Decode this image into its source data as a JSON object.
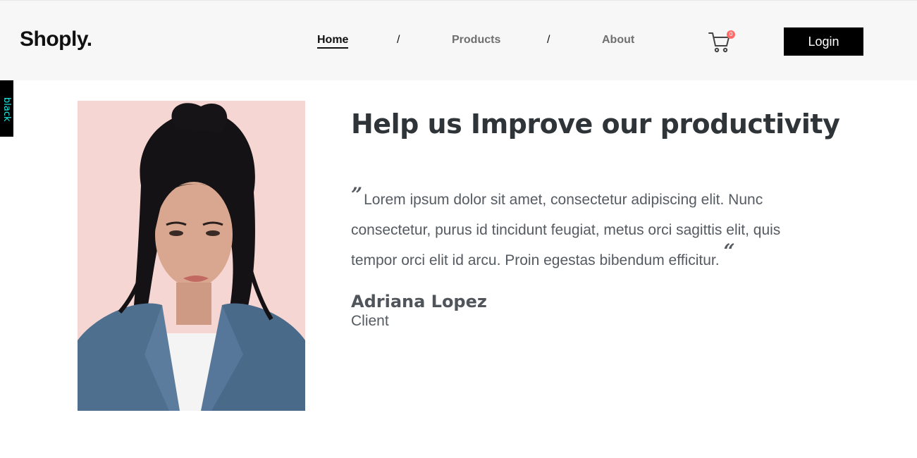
{
  "header": {
    "brand": "Shoply.",
    "nav": [
      {
        "label": "Home"
      },
      {
        "label": "Products"
      },
      {
        "label": "About"
      }
    ],
    "separator": "/",
    "cart_count": "0",
    "login_label": "Login"
  },
  "side_tab": {
    "label": "black"
  },
  "photo": {
    "icon": "portrait-photo"
  },
  "testimonial": {
    "headline": "Help us Improve our productivity",
    "open_quote": "”",
    "quote": "Lorem ipsum dolor sit amet, consectetur adipiscing elit. Nunc consectetur, purus id tincidunt feugiat, metus orci sagittis elit, quis tempor orci elit id arcu. Proin egestas bibendum efficitur.",
    "close_quote": "“",
    "author": "Adriana Lopez",
    "role": "Client"
  },
  "colors": {
    "header_bg": "#f7f7f7",
    "button_bg": "#000000",
    "badge": "#ff6b6b",
    "side_tab_text": "#1de9e0"
  }
}
